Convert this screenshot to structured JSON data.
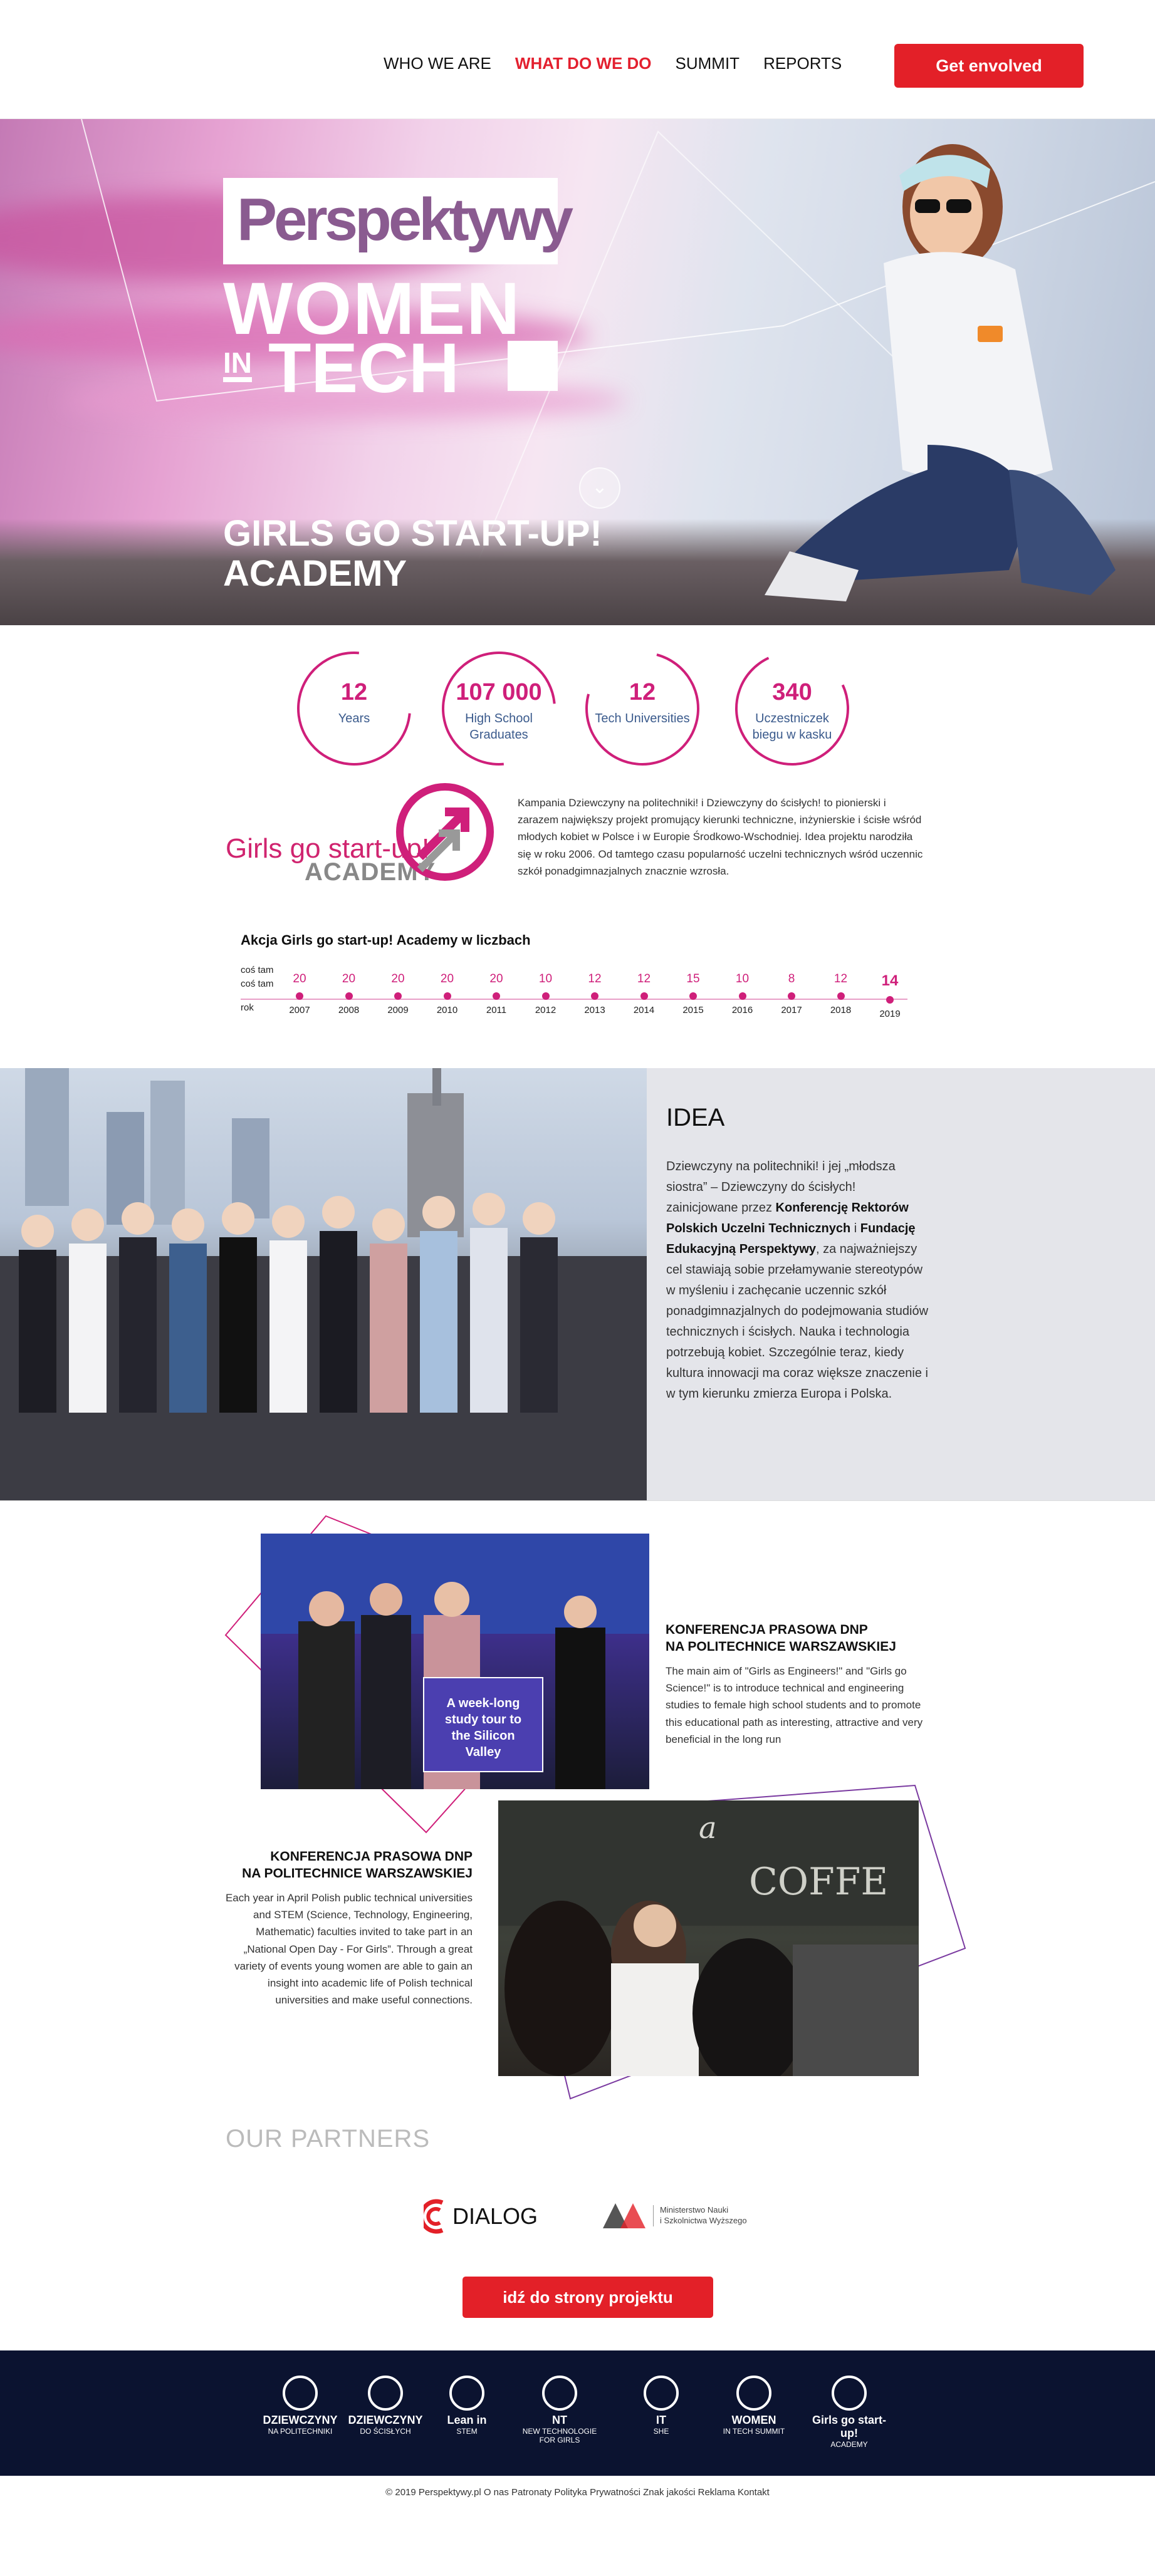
{
  "nav": {
    "items": [
      {
        "label": "WHO WE ARE"
      },
      {
        "label": "WHAT DO WE DO",
        "active": true
      },
      {
        "label": "SUMMIT"
      },
      {
        "label": "REPORTS"
      }
    ],
    "cta": "Get envolved"
  },
  "hero": {
    "logo_brand": "Perspektywy",
    "logo_women": "WOMEN",
    "logo_in": "IN",
    "logo_tech": "TECH",
    "title_line1": "GIRLS GO START-UP!",
    "title_line2": "ACADEMY"
  },
  "stats": [
    {
      "num": "12",
      "label": "Years"
    },
    {
      "num": "107 000",
      "label": "High School Graduates"
    },
    {
      "num": "12",
      "label": "Tech Universities"
    },
    {
      "num": "340",
      "label": "Uczestniczek biegu w kasku"
    }
  ],
  "academy": {
    "logo_text": "Girls go start-up!",
    "logo_sub": "ACADEMY",
    "description": "Kampania Dziewczyny na politechniki! i Dziewczyny do ścisłych! to pionierski i zarazem największy projekt promujący kierunki techniczne, inżynierskie i ścisłe wśród młodych kobiet w Polsce i w Europie Środkowo-Wschodniej. Idea projektu narodziła się w roku 2006. Od tamtego czasu popularność uczelni technicznych wśród uczennic szkół ponadgimnazjalnych znacznie wzrosła."
  },
  "timeline": {
    "title": "Akcja Girls go start-up! Academy w liczbach",
    "row_label_1": "coś tam",
    "row_label_2": "coś tam",
    "row_label_year": "rok",
    "points": [
      {
        "year": "2007",
        "value": "20"
      },
      {
        "year": "2008",
        "value": "20"
      },
      {
        "year": "2009",
        "value": "20"
      },
      {
        "year": "2010",
        "value": "20"
      },
      {
        "year": "2011",
        "value": "20"
      },
      {
        "year": "2012",
        "value": "10"
      },
      {
        "year": "2013",
        "value": "12"
      },
      {
        "year": "2014",
        "value": "12"
      },
      {
        "year": "2015",
        "value": "15"
      },
      {
        "year": "2016",
        "value": "10"
      },
      {
        "year": "2017",
        "value": "8"
      },
      {
        "year": "2018",
        "value": "12"
      },
      {
        "year": "2019",
        "value": "14"
      }
    ]
  },
  "idea": {
    "title": "IDEA",
    "p1": "Dziewczyny na politechniki! i jej „młodsza siostra” – Dziewczyny do ścisłych! zainicjowane przez ",
    "b1": "Konferencję Rektorów Polskich Uczelni Technicznych",
    "p2": " i ",
    "b2": "Fundację Edukacyjną Perspektywy",
    "p3": ", za najważniejszy cel stawiają sobie przełamywanie stereotypów w myśleniu i zachęcanie uczennic szkół ponadgimnazjalnych do podejmowania studiów technicznych i ścisłych. Nauka i technologia potrzebują kobiet. Szczególnie teraz, kiedy kultura innowacji ma coraz większe znaczenie i w tym kierunku zmierza Europa i Polska."
  },
  "press": [
    {
      "title1": "KONFERENCJA PRASOWA DNP",
      "title2": "NA POLITECHNICE WARSZAWSKIEJ",
      "text": "The main aim of \"Girls as Engineers!\" and \"Girls go Science!\" is to introduce technical and engineering studies to female high school students and to promote this educational path as interesting, attractive and very beneficial in the long run",
      "sign": "A week-long study tour to the Silicon Valley"
    },
    {
      "title1": "KONFERENCJA PRASOWA DNP",
      "title2": "NA POLITECHNICE WARSZAWSKIEJ",
      "text": "Each year in April Polish public technical universities and STEM (Science, Technology, Engineering, Mathematic) faculties invited to take part in an „National Open Day - For Girls”. Through a great variety of events young women are able to gain an insight into academic life of Polish technical universities and make useful connections."
    }
  ],
  "partners": {
    "title": "OUR PARTNERS",
    "dialog": "DIALOG",
    "ministry_line1": "Ministerstwo Nauki",
    "ministry_line2": "i Szkolnictwa Wyższego"
  },
  "project_button": "idź do strony projektu",
  "footer_logos": [
    {
      "line1": "DZIEWCZYNY",
      "line2": "NA POLITECHNIKI"
    },
    {
      "line1": "DZIEWCZYNY",
      "line2": "DO ŚCISŁYCH"
    },
    {
      "line1": "Lean in",
      "line2": "STEM"
    },
    {
      "line1": "NT",
      "line2": "NEW TECHNOLOGIE FOR GIRLS"
    },
    {
      "line1": "IT",
      "line2": "SHE"
    },
    {
      "line1": "WOMEN",
      "line2": "IN TECH SUMMIT"
    },
    {
      "line1": "Girls go start-up!",
      "line2": "ACADEMY"
    }
  ],
  "copyright": "© 2019 Perspektywy.pl O nas Patronaty Polityka Prywatności Znak jakości Reklama Kontakt",
  "colors": {
    "accent": "#e32028",
    "magenta": "#cf1f7a",
    "navy": "#0b1330"
  }
}
